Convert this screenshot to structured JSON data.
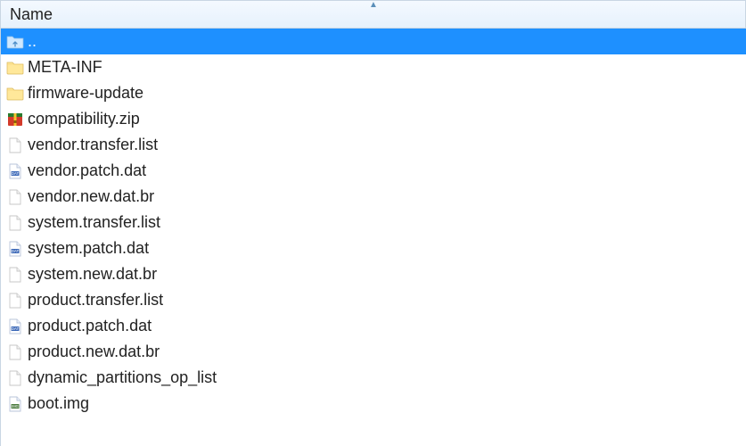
{
  "header": {
    "columns": [
      {
        "label": "Name",
        "sort": "asc"
      }
    ]
  },
  "selection_color": "#1e90ff",
  "items": [
    {
      "name": "..",
      "icon": "folder-up",
      "selected": true
    },
    {
      "name": "META-INF",
      "icon": "folder",
      "selected": false
    },
    {
      "name": "firmware-update",
      "icon": "folder",
      "selected": false
    },
    {
      "name": "compatibility.zip",
      "icon": "archive",
      "selected": false
    },
    {
      "name": "vendor.transfer.list",
      "icon": "file",
      "selected": false
    },
    {
      "name": "vendor.patch.dat",
      "icon": "dat",
      "selected": false
    },
    {
      "name": "vendor.new.dat.br",
      "icon": "file",
      "selected": false
    },
    {
      "name": "system.transfer.list",
      "icon": "file",
      "selected": false
    },
    {
      "name": "system.patch.dat",
      "icon": "dat",
      "selected": false
    },
    {
      "name": "system.new.dat.br",
      "icon": "file",
      "selected": false
    },
    {
      "name": "product.transfer.list",
      "icon": "file",
      "selected": false
    },
    {
      "name": "product.patch.dat",
      "icon": "dat",
      "selected": false
    },
    {
      "name": "product.new.dat.br",
      "icon": "file",
      "selected": false
    },
    {
      "name": "dynamic_partitions_op_list",
      "icon": "file",
      "selected": false
    },
    {
      "name": "boot.img",
      "icon": "img",
      "selected": false
    }
  ]
}
